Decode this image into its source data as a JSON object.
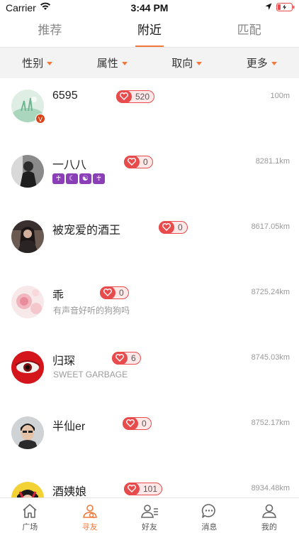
{
  "status_bar": {
    "carrier": "Carrier",
    "time": "3:44 PM"
  },
  "top_tabs": [
    {
      "label": "推荐",
      "active": false
    },
    {
      "label": "附近",
      "active": true
    },
    {
      "label": "匹配",
      "active": false
    }
  ],
  "filters": [
    {
      "label": "性别"
    },
    {
      "label": "属性"
    },
    {
      "label": "取向"
    },
    {
      "label": "更多"
    }
  ],
  "users": [
    {
      "name": "6595",
      "likes": "520",
      "distance": "100m",
      "subtitle": "",
      "verified": true,
      "tags": []
    },
    {
      "name": "一八八",
      "likes": "0",
      "distance": "8281.1km",
      "subtitle": "",
      "verified": false,
      "tags": [
        "♰",
        "☾",
        "☯",
        "♰"
      ]
    },
    {
      "name": "被宠爱的酒王",
      "likes": "0",
      "distance": "8617.05km",
      "subtitle": "",
      "verified": false,
      "tags": []
    },
    {
      "name": "乖",
      "likes": "0",
      "distance": "8725.24km",
      "subtitle": "有声音好听的狗狗吗",
      "verified": false,
      "tags": []
    },
    {
      "name": "归琛",
      "likes": "6",
      "distance": "8745.03km",
      "subtitle": "SWEET GARBAGE",
      "verified": false,
      "tags": []
    },
    {
      "name": "半仙er",
      "likes": "0",
      "distance": "8752.17km",
      "subtitle": "",
      "verified": false,
      "tags": []
    },
    {
      "name": "酒姨娘",
      "likes": "101",
      "distance": "8934.48km",
      "subtitle": "",
      "verified": false,
      "tags": []
    }
  ],
  "bottom_nav": [
    {
      "label": "广场",
      "icon": "home-icon",
      "active": false
    },
    {
      "label": "寻友",
      "icon": "find-friend-icon",
      "active": true
    },
    {
      "label": "好友",
      "icon": "friends-icon",
      "active": false
    },
    {
      "label": "消息",
      "icon": "message-icon",
      "active": false
    },
    {
      "label": "我的",
      "icon": "profile-icon",
      "active": false
    }
  ],
  "colors": {
    "accent": "#f07a3b",
    "like_red": "#e84b4b",
    "tag_purple": "#8b3fb7"
  }
}
